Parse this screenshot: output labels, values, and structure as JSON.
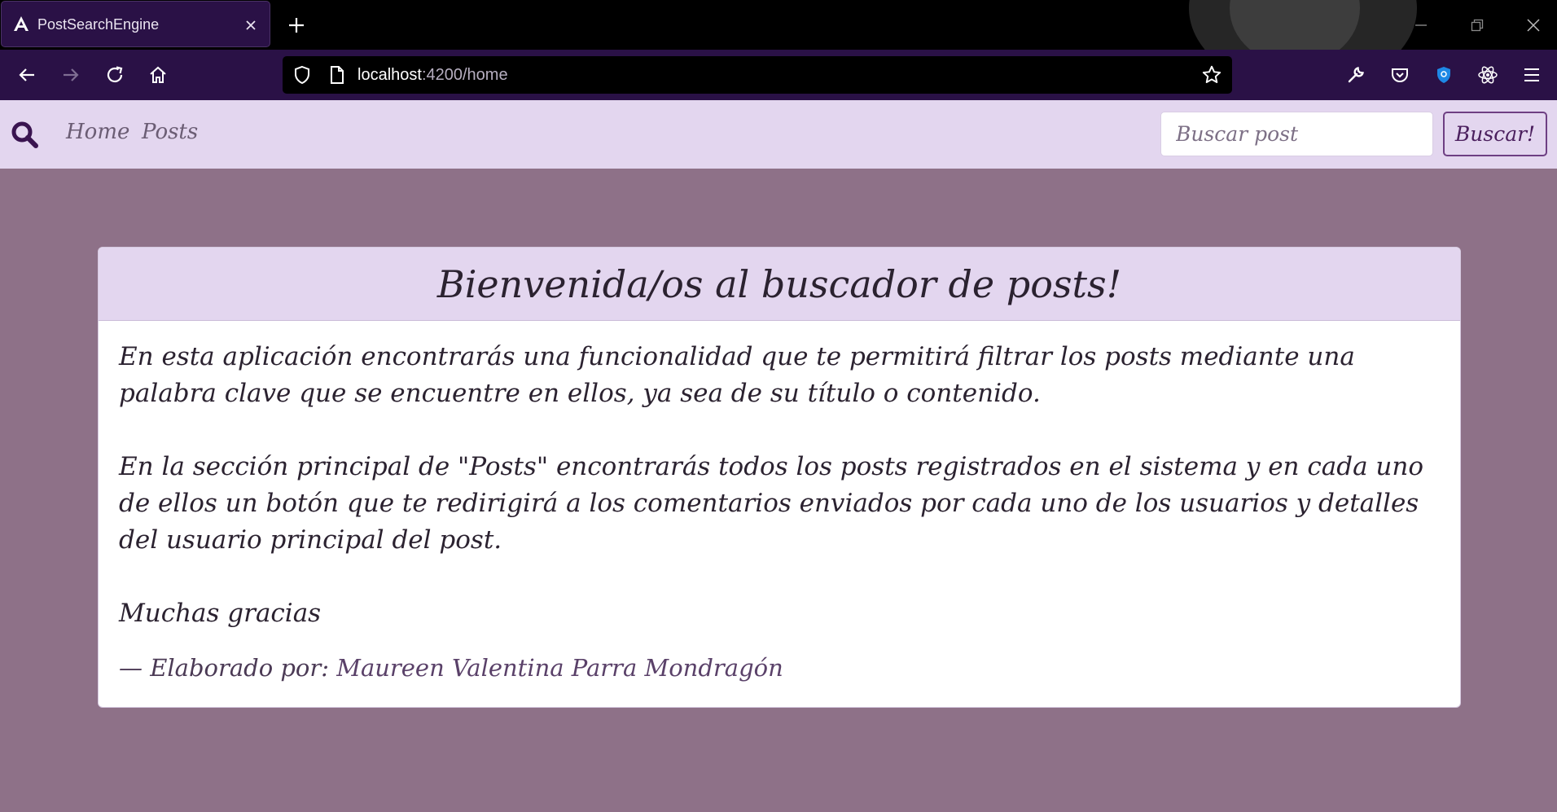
{
  "browser": {
    "tab_title": "PostSearchEngine",
    "url_host": "localhost",
    "url_path": ":4200/home"
  },
  "app": {
    "nav_home": "Home",
    "nav_posts": "Posts",
    "search_placeholder": "Buscar post",
    "search_button": "Buscar!",
    "colors": {
      "page_background": "#8e7188",
      "nav_background": "#e3d6ef",
      "accent": "#6e3f83"
    }
  },
  "card": {
    "title": "Bienvenida/os al buscador de posts!",
    "paragraph_1": "En esta aplicación encontrarás una funcionalidad que te permitirá filtrar los posts mediante una palabra clave que se encuentre en ellos, ya sea de su título o contenido.",
    "paragraph_2": "En la sección principal de \"Posts\" encontrarás todos los posts registrados en el sistema y en cada uno de ellos un botón que te redirigirá a los comentarios enviados por cada uno de los usuarios y detalles del usuario principal del post.",
    "thanks": "Muchas gracias",
    "footer_prefix": "— Elaborado por:",
    "footer_author": "Maureen Valentina Parra Mondragón"
  }
}
